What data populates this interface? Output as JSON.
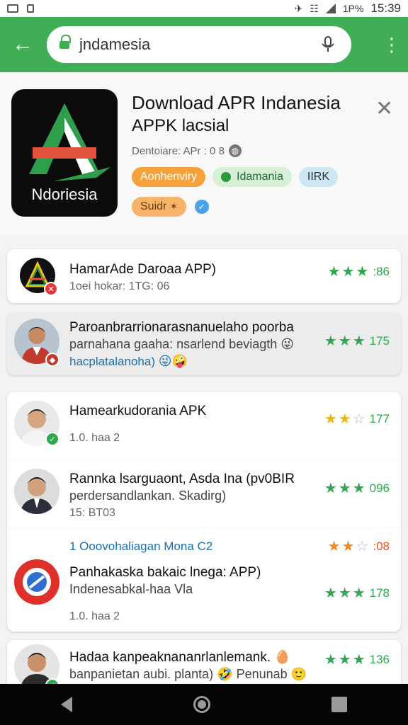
{
  "status_bar": {
    "battery": "1P%",
    "time": "15:39"
  },
  "toolbar": {
    "url_text": "jndamesia"
  },
  "header": {
    "title": "Download APR Indanesia",
    "subtitle": "APPK lacsial",
    "meta": "Dentoiare: APr : 0 8",
    "icon_brand": "Ndoriesia",
    "chips": [
      "Aonhenviry",
      "Idamania",
      "IIRK"
    ],
    "chip2": "Suidr"
  },
  "items": [
    {
      "title": "HamarAde Daroaa APP)",
      "line2": "1oei hokar: 1TG: 06",
      "rating": "86",
      "stars_filled": 3
    },
    {
      "title": "Paroanbrarrionarasnanuelaho poorba",
      "line2": "parnahana gaaha: nsarlend beviagth",
      "line3": "hacplatalanoha)",
      "rating": "175",
      "stars_filled": 3
    },
    {
      "title": "Hamearkudorania APK",
      "line3": "1.0. haa 2",
      "rating": "177",
      "stars_filled": 2
    },
    {
      "title": "Rannka lsarguaont, Asda Ina (pv0BIR",
      "line2": "perdersandlankan. Skadirg)",
      "line3": "15: BT03",
      "rating": "096",
      "stars_filled": 3
    },
    {
      "link": "1 Ooovohaliagan Mona C2",
      "rating": ":08",
      "stars_filled": 2
    },
    {
      "title": "Panhakaska bakaic lnega: APP)",
      "line2": "Indenesabkal-haa Vla",
      "line3": "1.0. haa 2",
      "rating": "178",
      "stars_filled": 3
    },
    {
      "title": "Hadaa kanpeaknananrlanlemank.",
      "line2": "banpanietan aubi. planta)",
      "line2b": "Penunab",
      "rating": "136",
      "stars_filled": 3
    }
  ],
  "colors": {
    "toolbar": "#3fae54",
    "star_green": "#2fa84f",
    "star_yellow": "#f2b400",
    "star_orange": "#f08a24"
  }
}
